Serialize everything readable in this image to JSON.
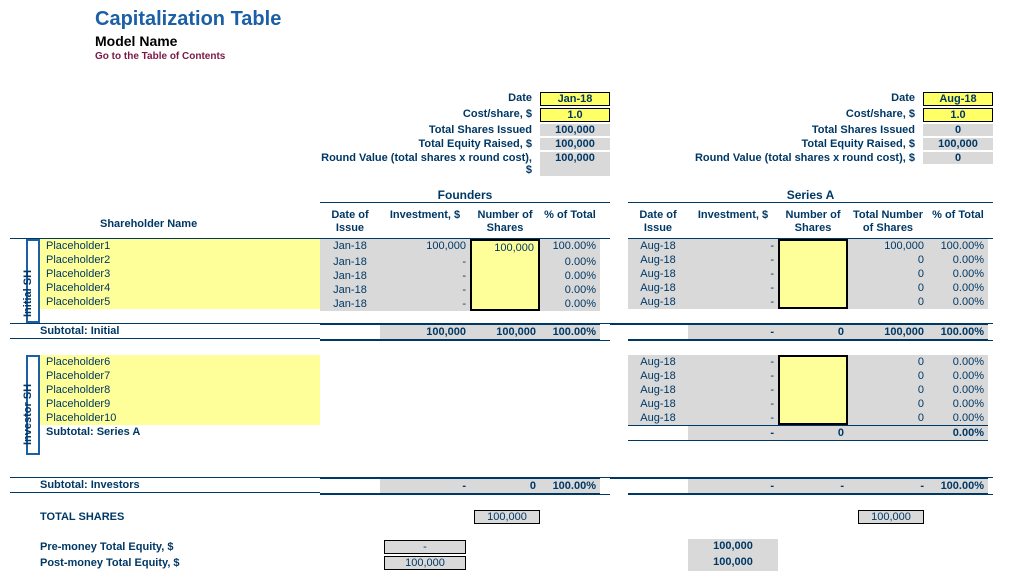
{
  "page": {
    "title": "Capitalization Table",
    "subtitle": "Model Name",
    "toc_link": "Go to the Table of Contents"
  },
  "rounds": {
    "founders": {
      "title": "Founders",
      "meta": {
        "date_label": "Date",
        "date": "Jan-18",
        "cost_label": "Cost/share, $",
        "cost": "1.0",
        "shares_label": "Total Shares Issued",
        "shares": "100,000",
        "equity_label": "Total Equity Raised, $",
        "equity": "100,000",
        "roundval_label": "Round Value (total shares x round cost), $",
        "roundval": "100,000"
      },
      "headers": {
        "date": "Date of Issue",
        "inv": "Investment, $",
        "num": "Number of Shares",
        "pct": "% of Total"
      }
    },
    "seriesa": {
      "title": "Series A",
      "meta": {
        "date_label": "Date",
        "date": "Aug-18",
        "cost_label": "Cost/share, $",
        "cost": "1.0",
        "shares_label": "Total Shares Issued",
        "shares": "0",
        "equity_label": "Total Equity Raised, $",
        "equity": "100,000",
        "roundval_label": "Round Value (total shares x round cost), $",
        "roundval": "0"
      },
      "headers": {
        "date": "Date of Issue",
        "inv": "Investment, $",
        "num": "Number of Shares",
        "tot": "Total Number of Shares",
        "pct": "% of Total"
      }
    }
  },
  "labels": {
    "shareholder_header": "Shareholder Name",
    "initial_side": "Initial SH",
    "investor_side": "Investor SH",
    "subtotal_initial": "Subtotal: Initial",
    "subtotal_seriesa": "Subtotal: Series A",
    "subtotal_investors": "Subtotal: Investors",
    "total_shares": "TOTAL SHARES",
    "pre_money": "Pre-money Total Equity, $",
    "post_money": "Post-money Total Equity, $"
  },
  "initial": [
    {
      "name": "Placeholder1",
      "f": {
        "date": "Jan-18",
        "inv": "100,000",
        "num": "100,000",
        "pct": "100.00%"
      },
      "s": {
        "date": "Aug-18",
        "inv": "-",
        "num": "",
        "tot": "100,000",
        "pct": "100.00%"
      }
    },
    {
      "name": "Placeholder2",
      "f": {
        "date": "Jan-18",
        "inv": "-",
        "num": "",
        "pct": "0.00%"
      },
      "s": {
        "date": "Aug-18",
        "inv": "-",
        "num": "",
        "tot": "0",
        "pct": "0.00%"
      }
    },
    {
      "name": "Placeholder3",
      "f": {
        "date": "Jan-18",
        "inv": "-",
        "num": "",
        "pct": "0.00%"
      },
      "s": {
        "date": "Aug-18",
        "inv": "-",
        "num": "",
        "tot": "0",
        "pct": "0.00%"
      }
    },
    {
      "name": "Placeholder4",
      "f": {
        "date": "Jan-18",
        "inv": "-",
        "num": "",
        "pct": "0.00%"
      },
      "s": {
        "date": "Aug-18",
        "inv": "-",
        "num": "",
        "tot": "0",
        "pct": "0.00%"
      }
    },
    {
      "name": "Placeholder5",
      "f": {
        "date": "Jan-18",
        "inv": "-",
        "num": "",
        "pct": "0.00%"
      },
      "s": {
        "date": "Aug-18",
        "inv": "-",
        "num": "",
        "tot": "0",
        "pct": "0.00%"
      }
    }
  ],
  "sub_initial": {
    "f": {
      "inv": "100,000",
      "num": "100,000",
      "pct": "100.00%"
    },
    "s": {
      "inv": "-",
      "num": "0",
      "tot": "100,000",
      "pct": "100.00%"
    }
  },
  "investors": [
    {
      "name": "Placeholder6",
      "s": {
        "date": "Aug-18",
        "inv": "-",
        "num": "",
        "tot": "0",
        "pct": "0.00%"
      }
    },
    {
      "name": "Placeholder7",
      "s": {
        "date": "Aug-18",
        "inv": "-",
        "num": "",
        "tot": "0",
        "pct": "0.00%"
      }
    },
    {
      "name": "Placeholder8",
      "s": {
        "date": "Aug-18",
        "inv": "-",
        "num": "",
        "tot": "0",
        "pct": "0.00%"
      }
    },
    {
      "name": "Placeholder9",
      "s": {
        "date": "Aug-18",
        "inv": "-",
        "num": "",
        "tot": "0",
        "pct": "0.00%"
      }
    },
    {
      "name": "Placeholder10",
      "s": {
        "date": "Aug-18",
        "inv": "-",
        "num": "",
        "tot": "0",
        "pct": "0.00%"
      }
    }
  ],
  "sub_seriesa": {
    "s": {
      "inv": "-",
      "num": "0",
      "tot": "",
      "pct": "0.00%"
    }
  },
  "sub_investors": {
    "f": {
      "inv": "-",
      "num": "0",
      "pct": "100.00%"
    },
    "s": {
      "inv": "-",
      "num": "-",
      "tot": "-",
      "pct": "100.00%"
    }
  },
  "totals": {
    "total_shares_f": "100,000",
    "total_shares_s": "100,000",
    "pre_f": "-",
    "pre_s": "100,000",
    "post_f": "100,000",
    "post_s": "100,000"
  }
}
